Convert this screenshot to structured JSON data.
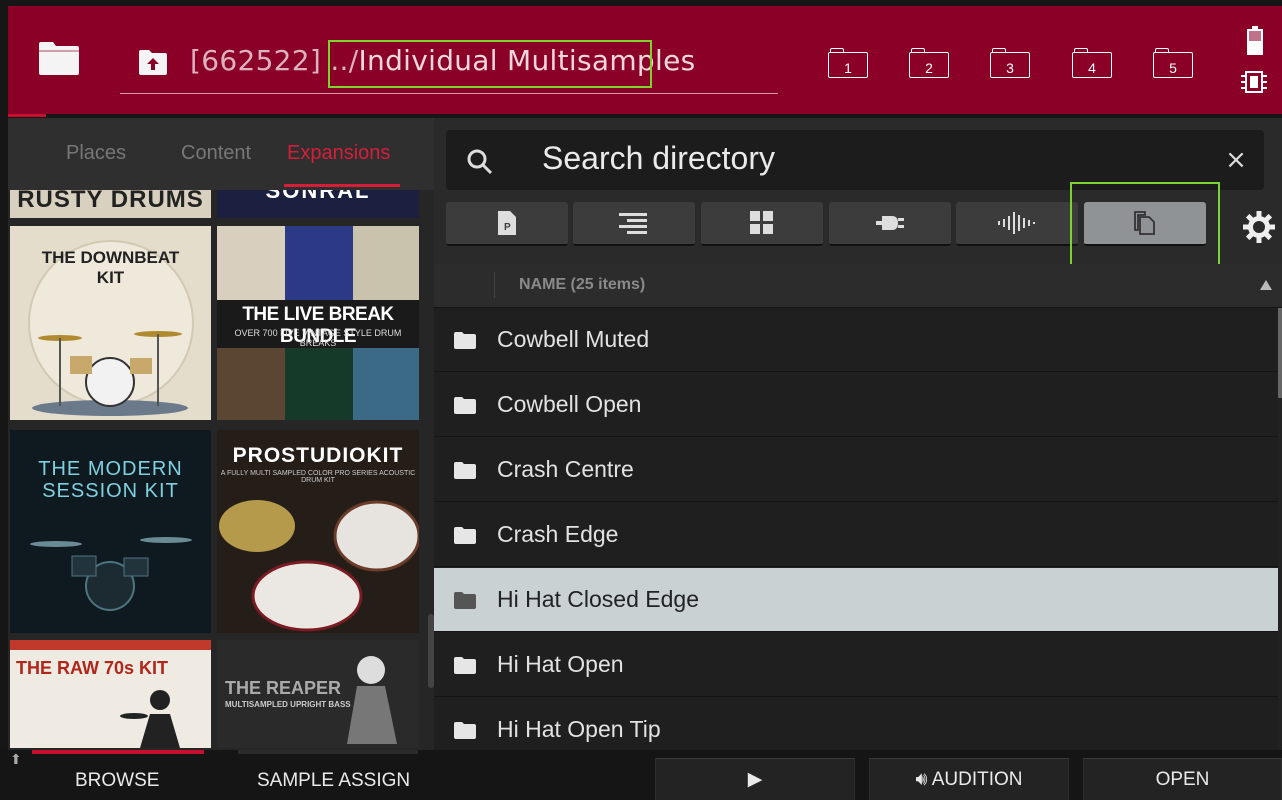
{
  "header": {
    "path_prefix": "[662522] ../",
    "path_current": "Individual Multisamples",
    "slots": [
      "1",
      "2",
      "3",
      "4",
      "5"
    ]
  },
  "left_panel": {
    "tabs": [
      {
        "label": "Places",
        "active": false
      },
      {
        "label": "Content",
        "active": false
      },
      {
        "label": "Expansions",
        "active": true
      }
    ],
    "covers": [
      {
        "title": "RUSTY DRUMS"
      },
      {
        "title": "SONRAL"
      },
      {
        "title": "THE DOWNBEAT KIT"
      },
      {
        "title": "THE LIVE BREAK BUNDLE",
        "subtitle": "OVER 700 LIVE VINTAGE STYLE DRUM BREAKS"
      },
      {
        "title": "THE MODERN SESSION KIT"
      },
      {
        "title": "PROSTUDIOKIT",
        "subtitle": "A FULLY MULTI SAMPLED COLOR PRO SERIES ACOUSTIC DRUM KIT"
      },
      {
        "title": "THE RAW 70s KIT"
      },
      {
        "title": "THE REAPER",
        "subtitle": "MULTISAMPLED UPRIGHT BASS"
      }
    ]
  },
  "search": {
    "placeholder": "Search directory",
    "filters": [
      "program-icon",
      "list-icon",
      "grid-icon",
      "plugin-icon",
      "waveform-icon",
      "multisample-icon"
    ],
    "selected_filter": "multisample-icon"
  },
  "list": {
    "header": "NAME (25 items)",
    "items": [
      {
        "name": "Cowbell Muted",
        "selected": false
      },
      {
        "name": "Cowbell Open",
        "selected": false
      },
      {
        "name": "Crash Centre",
        "selected": false
      },
      {
        "name": "Crash Edge",
        "selected": false
      },
      {
        "name": "Hi Hat Closed Edge",
        "selected": true
      },
      {
        "name": "Hi Hat Open",
        "selected": false
      },
      {
        "name": "Hi Hat Open Tip",
        "selected": false
      }
    ]
  },
  "bottom_bar": {
    "browse": "BROWSE",
    "sample_assign": "SAMPLE ASSIGN",
    "play": "▶",
    "audition": "AUDITION",
    "open": "OPEN"
  },
  "colors": {
    "header_bg": "#8a0026",
    "accent": "#d61e3b",
    "highlight_box": "#7cd32e",
    "selected_row": "#c9d1d3"
  }
}
